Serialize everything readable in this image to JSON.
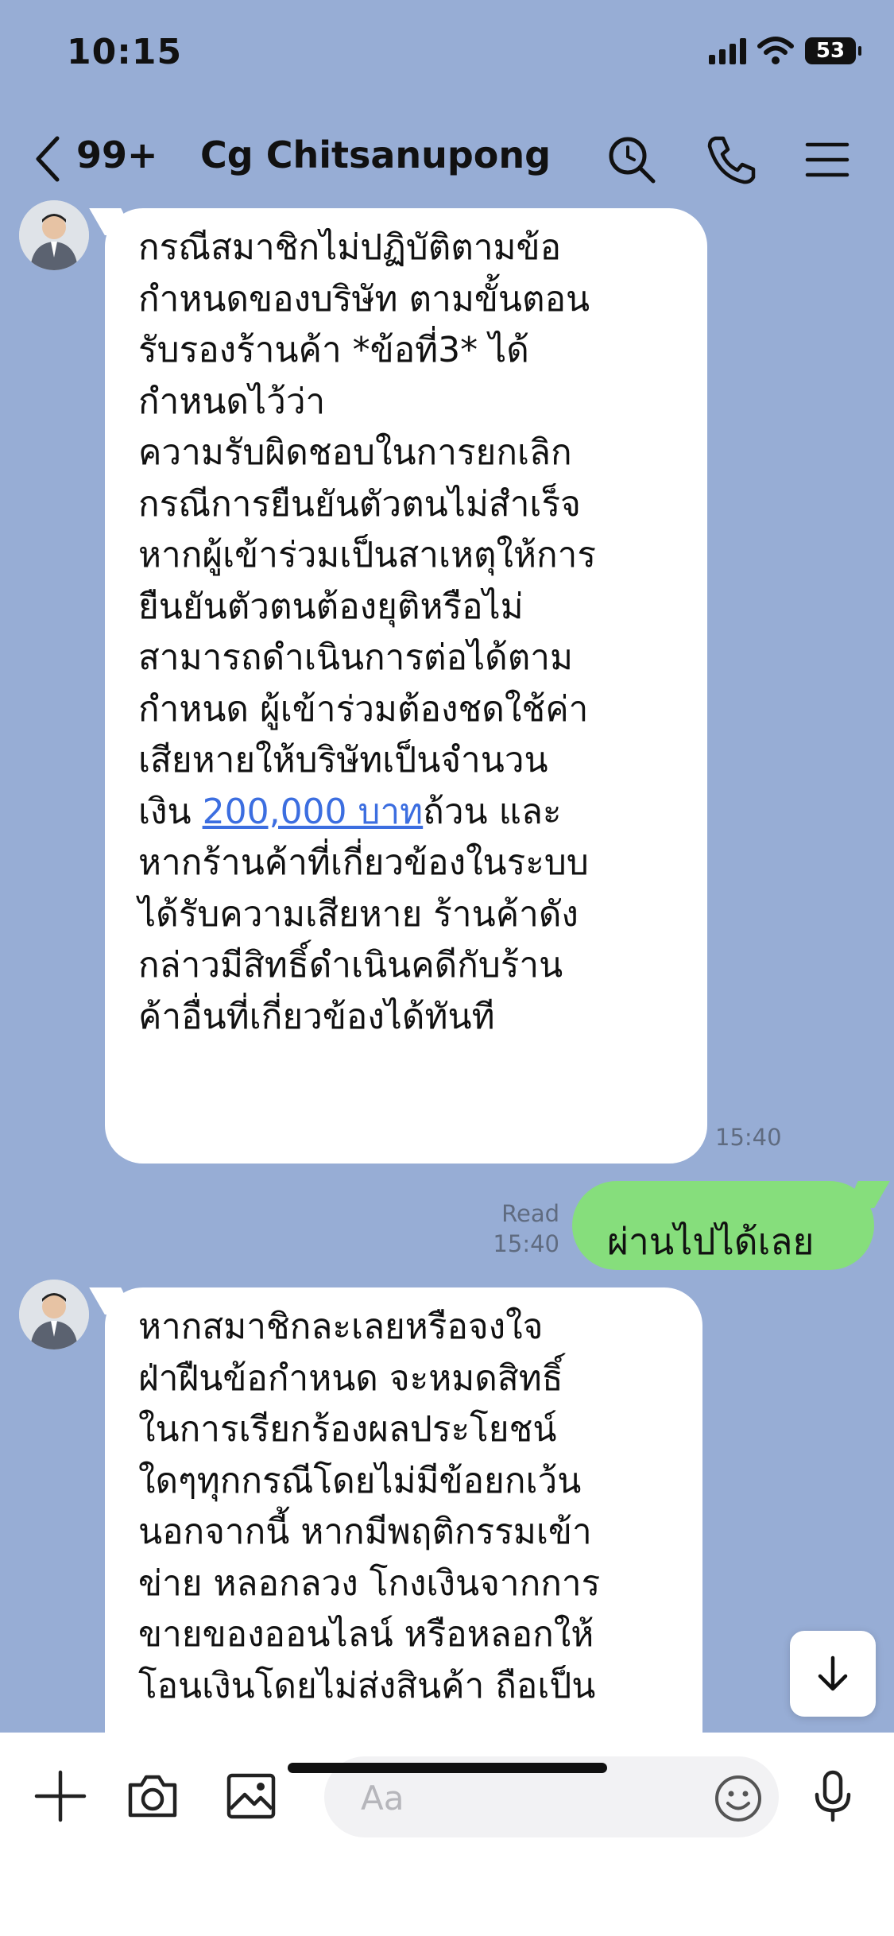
{
  "status_bar": {
    "time": "10:15",
    "battery": "53"
  },
  "header": {
    "back_count": "99+",
    "title": "Cg Chitsanupong"
  },
  "messages": [
    {
      "direction": "in",
      "text_before_link": "กรณีสมาชิกไม่ปฏิบัติตามข้อ\nกำหนดของบริษัท ตามขั้นตอน\nรับรองร้านค้า *ข้อที่3* ได้\nกำหนดไว้ว่า\nความรับผิดชอบในการยกเลิก\nกรณีการยืนยันตัวตนไม่สำเร็จ\nหากผู้เข้าร่วมเป็นสาเหตุให้การ\nยืนยันตัวตนต้องยุติหรือไม่\nสามารถดำเนินการต่อได้ตาม\nกำหนด ผู้เข้าร่วมต้องชดใช้ค่า\nเสียหายให้บริษัทเป็นจำนวน\nเงิน ",
      "link_text": "200,000 บาท",
      "text_after_link": "ถ้วน และ\nหากร้านค้าที่เกี่ยวข้องในระบบ\nได้รับความเสียหาย ร้านค้าดัง\nกล่าวมีสิทธิ์ดำเนินคดีกับร้าน\nค้าอื่นที่เกี่ยวข้องได้ทันที",
      "time": "15:40"
    },
    {
      "direction": "out",
      "text": "ผ่านไปได้เลย",
      "read_label": "Read",
      "time": "15:40"
    },
    {
      "direction": "in",
      "text": "หากสมาชิกละเลยหรือจงใจ\nฝ่าฝืนข้อกำหนด จะหมดสิทธิ์\nในการเรียกร้องผลประโยชน์\nใดๆทุกกรณีโดยไม่มีข้อยกเว้น\nนอกจากนี้ หากมีพฤติกรรมเข้า\nข่าย หลอกลวง โกงเงินจากการ\nขายของออนไลน์ หรือหลอกให้\nโอนเงินโดยไม่ส่งสินค้า ถือเป็น"
    }
  ],
  "input": {
    "placeholder": "Aa"
  },
  "icons": {
    "back": "chevron-left-icon",
    "search": "search-icon",
    "call": "phone-icon",
    "menu": "menu-icon",
    "add": "plus-icon",
    "camera": "camera-icon",
    "image": "image-icon",
    "emoji": "emoji-icon",
    "mic": "microphone-icon",
    "scroll": "arrow-down-icon"
  },
  "colors": {
    "background": "#97add5",
    "incoming_bubble": "#ffffff",
    "outgoing_bubble": "#86de7c",
    "link": "#3c6ee0"
  }
}
